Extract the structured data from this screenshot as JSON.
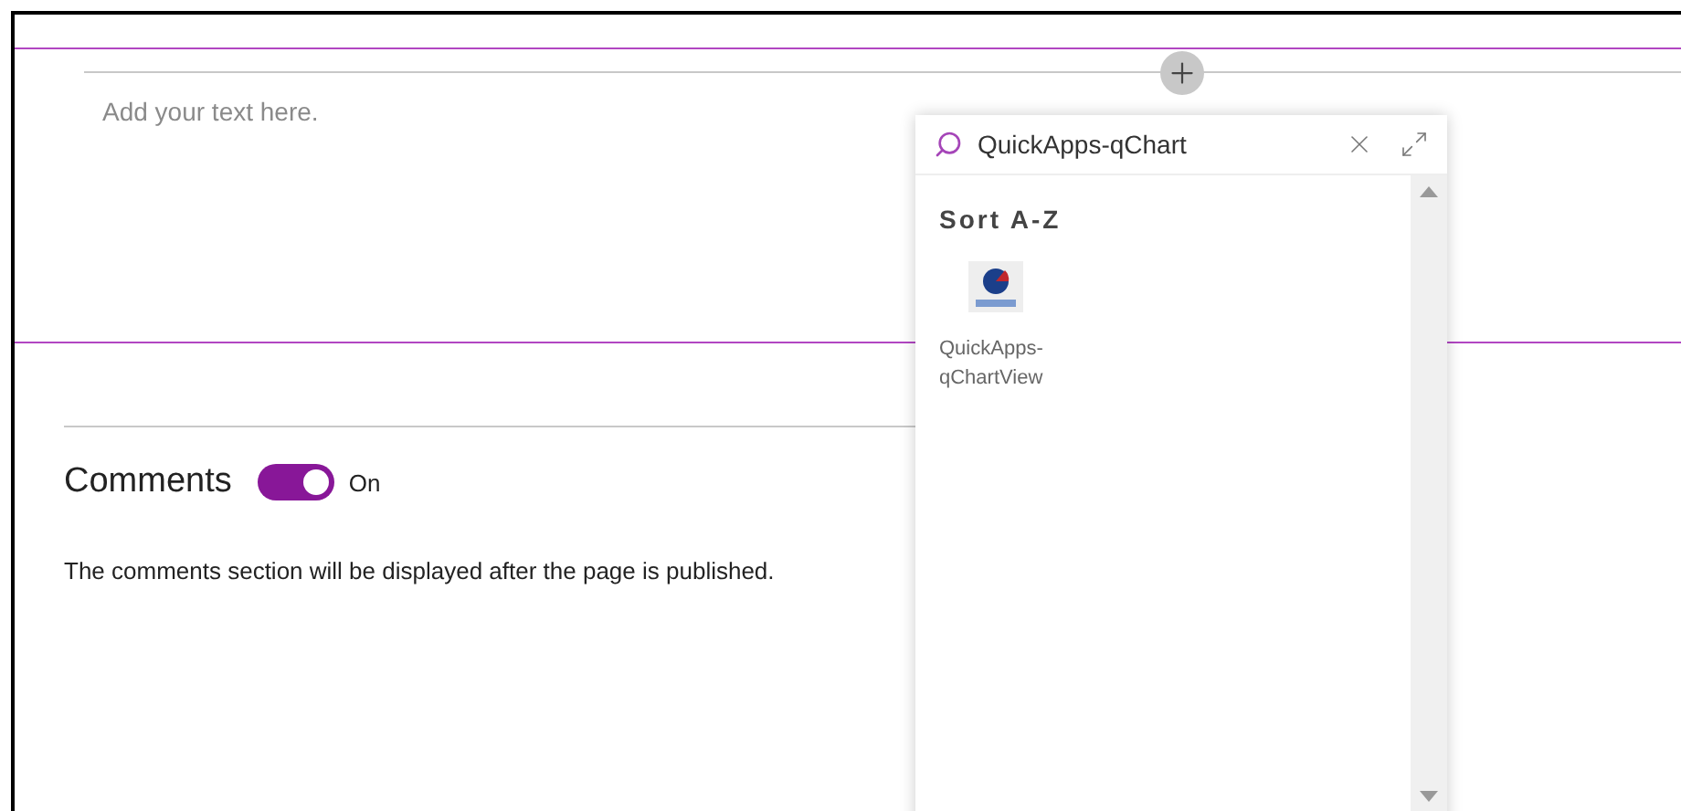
{
  "editor": {
    "placeholder": "Add your text here."
  },
  "picker": {
    "search_value": "QuickApps-qChart",
    "section_title": "Sort A-Z",
    "results": [
      {
        "name": "QuickApps-\nqChartView"
      }
    ]
  },
  "comments": {
    "title": "Comments",
    "toggle": {
      "on": true,
      "label": "On"
    },
    "note": "The comments section will be displayed after the page is published."
  }
}
